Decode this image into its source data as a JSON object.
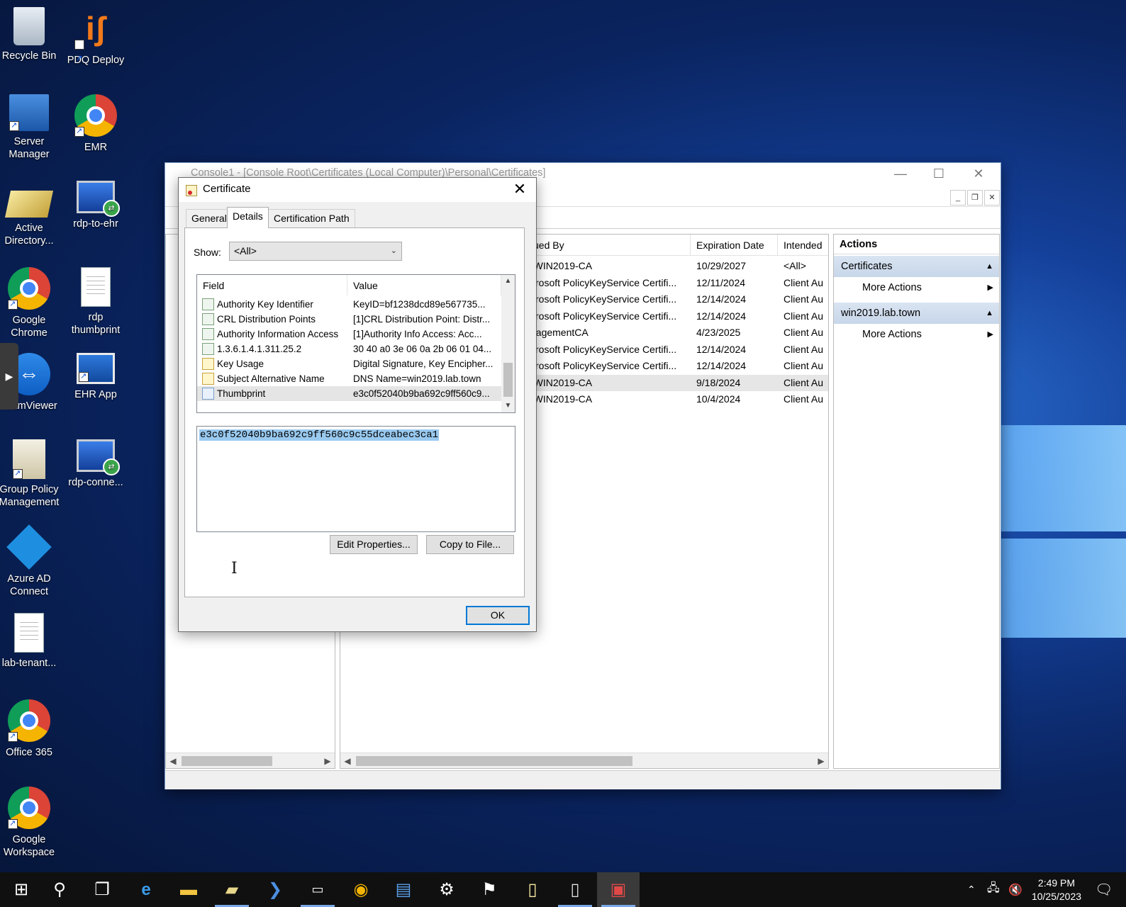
{
  "desktop": {
    "icons": [
      {
        "label": "Recycle Bin",
        "icon": "recycle-bin-icon"
      },
      {
        "label": "PDQ Deploy",
        "icon": "pdq-deploy-icon"
      },
      {
        "label": "Server Manager",
        "icon": "server-manager-icon"
      },
      {
        "label": "EMR",
        "icon": "chrome-icon"
      },
      {
        "label": "Active Directory...",
        "icon": "active-directory-icon"
      },
      {
        "label": "rdp-to-ehr",
        "icon": "rdp-icon"
      },
      {
        "label": "Google Chrome",
        "icon": "chrome-icon"
      },
      {
        "label": "rdp thumbprint",
        "icon": "text-document-icon"
      },
      {
        "label": "TeamViewer",
        "icon": "teamviewer-icon"
      },
      {
        "label": "EHR App",
        "icon": "ehr-app-icon"
      },
      {
        "label": "Group Policy Management",
        "icon": "group-policy-icon"
      },
      {
        "label": "rdp-conne...",
        "icon": "rdp-icon"
      },
      {
        "label": "Azure AD Connect",
        "icon": "azure-ad-connect-icon"
      },
      {
        "label": "lab-tenant...",
        "icon": "text-document-icon"
      },
      {
        "label": "Office 365",
        "icon": "chrome-icon"
      },
      {
        "label": "Google Workspace",
        "icon": "chrome-icon"
      }
    ]
  },
  "mmc": {
    "title": "Console1 - [Console Root\\Certificates (Local Computer)\\Personal\\Certificates]",
    "columns": {
      "issued_by": "ued By",
      "expiration": "Expiration Date",
      "intended": "Intended"
    },
    "rows": [
      {
        "issued_by": "-WIN2019-CA",
        "expiration": "10/29/2027",
        "intended": "<All>"
      },
      {
        "issued_by": "crosoft PolicyKeyService Certifi...",
        "expiration": "12/11/2024",
        "intended": "Client Au"
      },
      {
        "issued_by": "crosoft PolicyKeyService Certifi...",
        "expiration": "12/14/2024",
        "intended": "Client Au"
      },
      {
        "issued_by": "crosoft PolicyKeyService Certifi...",
        "expiration": "12/14/2024",
        "intended": "Client Au"
      },
      {
        "issued_by": "nagementCA",
        "expiration": "4/23/2025",
        "intended": "Client Au"
      },
      {
        "issued_by": "crosoft PolicyKeyService Certifi...",
        "expiration": "12/14/2024",
        "intended": "Client Au"
      },
      {
        "issued_by": "crosoft PolicyKeyService Certifi...",
        "expiration": "12/14/2024",
        "intended": "Client Au"
      },
      {
        "issued_by": "-WIN2019-CA",
        "expiration": "9/18/2024",
        "intended": "Client Au"
      },
      {
        "issued_by": "-WIN2019-CA",
        "expiration": "10/4/2024",
        "intended": "Client Au"
      }
    ],
    "actions": {
      "title": "Actions",
      "groups": [
        {
          "label": "Certificates",
          "item": "More Actions"
        },
        {
          "label": "win2019.lab.town",
          "item": "More Actions"
        }
      ]
    }
  },
  "cert_dialog": {
    "title": "Certificate",
    "tabs": [
      "General",
      "Details",
      "Certification Path"
    ],
    "show_label": "Show:",
    "show_value": "<All>",
    "field_header": "Field",
    "value_header": "Value",
    "fields": [
      {
        "name": "Authority Key Identifier",
        "value": "KeyID=bf1238dcd89e567735...",
        "icon": "extension-icon"
      },
      {
        "name": "CRL Distribution Points",
        "value": "[1]CRL Distribution Point: Distr...",
        "icon": "extension-icon"
      },
      {
        "name": "Authority Information Access",
        "value": "[1]Authority Info Access: Acc...",
        "icon": "extension-icon"
      },
      {
        "name": "1.3.6.1.4.1.311.25.2",
        "value": "30 40 a0 3e 06 0a 2b 06 01 04...",
        "icon": "extension-icon"
      },
      {
        "name": "Key Usage",
        "value": "Digital Signature, Key Encipher...",
        "icon": "critical-extension-icon"
      },
      {
        "name": "Subject Alternative Name",
        "value": "DNS Name=win2019.lab.town",
        "icon": "critical-extension-icon"
      },
      {
        "name": "Thumbprint",
        "value": "e3c0f52040b9ba692c9ff560c9...",
        "icon": "property-icon"
      }
    ],
    "selected_value": "e3c0f52040b9ba692c9ff560c9c55dceabec3ca1",
    "edit_properties": "Edit Properties...",
    "copy_to_file": "Copy to File...",
    "ok": "OK"
  },
  "taskbar": {
    "time": "2:49 PM",
    "date": "10/25/2023"
  }
}
